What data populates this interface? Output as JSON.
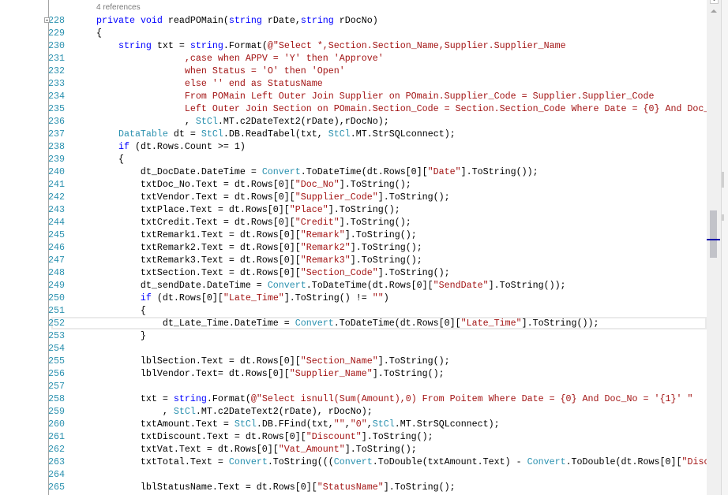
{
  "editor": {
    "codelens": "4 references",
    "current_line": 252,
    "colors": {
      "keyword": "#0000ff",
      "type": "#2b91af",
      "string": "#a31515",
      "line_number": "#2b91af"
    },
    "lines": [
      {
        "num": "228",
        "fold": true,
        "tokens": [
          [
            "p",
            "        "
          ],
          [
            "k",
            "private"
          ],
          [
            "p",
            " "
          ],
          [
            "k",
            "void"
          ],
          [
            "p",
            " readPOMain("
          ],
          [
            "k",
            "string"
          ],
          [
            "p",
            " rDate,"
          ],
          [
            "k",
            "string"
          ],
          [
            "p",
            " rDocNo)"
          ]
        ]
      },
      {
        "num": "229",
        "tokens": [
          [
            "p",
            "        {"
          ]
        ]
      },
      {
        "num": "230",
        "tokens": [
          [
            "p",
            "            "
          ],
          [
            "k",
            "string"
          ],
          [
            "p",
            " txt = "
          ],
          [
            "k",
            "string"
          ],
          [
            "p",
            ".Format("
          ],
          [
            "s",
            "@\"Select *,Section.Section_Name,Supplier.Supplier_Name"
          ]
        ]
      },
      {
        "num": "231",
        "tokens": [
          [
            "p",
            "                        "
          ],
          [
            "s",
            ",case when APPV = 'Y' then 'Approve'"
          ]
        ]
      },
      {
        "num": "232",
        "tokens": [
          [
            "p",
            "                        "
          ],
          [
            "s",
            "when Status = 'O' then 'Open'"
          ]
        ]
      },
      {
        "num": "233",
        "tokens": [
          [
            "p",
            "                        "
          ],
          [
            "s",
            "else '' end as StatusName"
          ]
        ]
      },
      {
        "num": "234",
        "tokens": [
          [
            "p",
            "                        "
          ],
          [
            "s",
            "From POMain Left Outer Join Supplier on POmain.Supplier_Code = Supplier.Supplier_Code"
          ]
        ]
      },
      {
        "num": "235",
        "tokens": [
          [
            "p",
            "                        "
          ],
          [
            "s",
            "Left Outer Join Section on POmain.Section_Code = Section.Section_Code Where Date = {0} And Doc_"
          ]
        ]
      },
      {
        "num": "236",
        "tokens": [
          [
            "p",
            "                        , "
          ],
          [
            "t",
            "StCl"
          ],
          [
            "p",
            ".MT.c2DateText2(rDate),rDocNo);"
          ]
        ]
      },
      {
        "num": "237",
        "tokens": [
          [
            "p",
            "            "
          ],
          [
            "t",
            "DataTable"
          ],
          [
            "p",
            " dt = "
          ],
          [
            "t",
            "StCl"
          ],
          [
            "p",
            ".DB.ReadTabel(txt, "
          ],
          [
            "t",
            "StCl"
          ],
          [
            "p",
            ".MT.StrSQLconnect);"
          ]
        ]
      },
      {
        "num": "238",
        "tokens": [
          [
            "p",
            "            "
          ],
          [
            "k",
            "if"
          ],
          [
            "p",
            " (dt.Rows.Count >= 1)"
          ]
        ]
      },
      {
        "num": "239",
        "tokens": [
          [
            "p",
            "            {"
          ]
        ]
      },
      {
        "num": "240",
        "tokens": [
          [
            "p",
            "                dt_DocDate.DateTime = "
          ],
          [
            "t",
            "Convert"
          ],
          [
            "p",
            ".ToDateTime(dt.Rows[0]["
          ],
          [
            "s",
            "\"Date\""
          ],
          [
            "p",
            "].ToString());"
          ]
        ]
      },
      {
        "num": "241",
        "tokens": [
          [
            "p",
            "                txtDoc_No.Text = dt.Rows[0]["
          ],
          [
            "s",
            "\"Doc_No\""
          ],
          [
            "p",
            "].ToString();"
          ]
        ]
      },
      {
        "num": "242",
        "tokens": [
          [
            "p",
            "                txtVendor.Text = dt.Rows[0]["
          ],
          [
            "s",
            "\"Supplier_Code\""
          ],
          [
            "p",
            "].ToString();"
          ]
        ]
      },
      {
        "num": "243",
        "tokens": [
          [
            "p",
            "                txtPlace.Text = dt.Rows[0]["
          ],
          [
            "s",
            "\"Place\""
          ],
          [
            "p",
            "].ToString();"
          ]
        ]
      },
      {
        "num": "244",
        "tokens": [
          [
            "p",
            "                txtCredit.Text = dt.Rows[0]["
          ],
          [
            "s",
            "\"Credit\""
          ],
          [
            "p",
            "].ToString();"
          ]
        ]
      },
      {
        "num": "245",
        "tokens": [
          [
            "p",
            "                txtRemark1.Text = dt.Rows[0]["
          ],
          [
            "s",
            "\"Remark\""
          ],
          [
            "p",
            "].ToString();"
          ]
        ]
      },
      {
        "num": "246",
        "tokens": [
          [
            "p",
            "                txtRemark2.Text = dt.Rows[0]["
          ],
          [
            "s",
            "\"Remark2\""
          ],
          [
            "p",
            "].ToString();"
          ]
        ]
      },
      {
        "num": "247",
        "tokens": [
          [
            "p",
            "                txtRemark3.Text = dt.Rows[0]["
          ],
          [
            "s",
            "\"Remark3\""
          ],
          [
            "p",
            "].ToString();"
          ]
        ]
      },
      {
        "num": "248",
        "tokens": [
          [
            "p",
            "                txtSection.Text = dt.Rows[0]["
          ],
          [
            "s",
            "\"Section_Code\""
          ],
          [
            "p",
            "].ToString();"
          ]
        ]
      },
      {
        "num": "249",
        "tokens": [
          [
            "p",
            "                dt_sendDate.DateTime = "
          ],
          [
            "t",
            "Convert"
          ],
          [
            "p",
            ".ToDateTime(dt.Rows[0]["
          ],
          [
            "s",
            "\"SendDate\""
          ],
          [
            "p",
            "].ToString());"
          ]
        ]
      },
      {
        "num": "250",
        "tokens": [
          [
            "p",
            "                "
          ],
          [
            "k",
            "if"
          ],
          [
            "p",
            " (dt.Rows[0]["
          ],
          [
            "s",
            "\"Late_Time\""
          ],
          [
            "p",
            "].ToString() != "
          ],
          [
            "s",
            "\"\""
          ],
          [
            "p",
            ")"
          ]
        ]
      },
      {
        "num": "251",
        "tokens": [
          [
            "p",
            "                {"
          ]
        ]
      },
      {
        "num": "252",
        "tokens": [
          [
            "p",
            "                    dt_Late_Time.DateTime = "
          ],
          [
            "t",
            "Convert"
          ],
          [
            "p",
            ".ToDateTime(dt.Rows[0]["
          ],
          [
            "s",
            "\"Late_Time\""
          ],
          [
            "p",
            "].ToString());"
          ]
        ]
      },
      {
        "num": "253",
        "tokens": [
          [
            "p",
            "                }"
          ]
        ]
      },
      {
        "num": "254",
        "tokens": []
      },
      {
        "num": "255",
        "tokens": [
          [
            "p",
            "                lblSection.Text = dt.Rows[0]["
          ],
          [
            "s",
            "\"Section_Name\""
          ],
          [
            "p",
            "].ToString();"
          ]
        ]
      },
      {
        "num": "256",
        "tokens": [
          [
            "p",
            "                lblVendor.Text= dt.Rows[0]["
          ],
          [
            "s",
            "\"Supplier_Name\""
          ],
          [
            "p",
            "].ToString();"
          ]
        ]
      },
      {
        "num": "257",
        "tokens": []
      },
      {
        "num": "258",
        "tokens": [
          [
            "p",
            "                txt = "
          ],
          [
            "k",
            "string"
          ],
          [
            "p",
            ".Format("
          ],
          [
            "s",
            "@\"Select isnull(Sum(Amount),0) From Poitem Where Date = {0} And Doc_No = '{1}' \""
          ]
        ]
      },
      {
        "num": "259",
        "tokens": [
          [
            "p",
            "                    , "
          ],
          [
            "t",
            "StCl"
          ],
          [
            "p",
            ".MT.c2DateText2(rDate), rDocNo);"
          ]
        ]
      },
      {
        "num": "260",
        "tokens": [
          [
            "p",
            "                txtAmount.Text = "
          ],
          [
            "t",
            "StCl"
          ],
          [
            "p",
            ".DB.FFind(txt,"
          ],
          [
            "s",
            "\"\""
          ],
          [
            "p",
            ","
          ],
          [
            "s",
            "\"0\""
          ],
          [
            "p",
            ","
          ],
          [
            "t",
            "StCl"
          ],
          [
            "p",
            ".MT.StrSQLconnect);"
          ]
        ]
      },
      {
        "num": "261",
        "tokens": [
          [
            "p",
            "                txtDiscount.Text = dt.Rows[0]["
          ],
          [
            "s",
            "\"Discount\""
          ],
          [
            "p",
            "].ToString();"
          ]
        ]
      },
      {
        "num": "262",
        "tokens": [
          [
            "p",
            "                txtVat.Text = dt.Rows[0]["
          ],
          [
            "s",
            "\"Vat_Amount\""
          ],
          [
            "p",
            "].ToString();"
          ]
        ]
      },
      {
        "num": "263",
        "tokens": [
          [
            "p",
            "                txtTotal.Text = "
          ],
          [
            "t",
            "Convert"
          ],
          [
            "p",
            ".ToString((("
          ],
          [
            "t",
            "Convert"
          ],
          [
            "p",
            ".ToDouble(txtAmount.Text) - "
          ],
          [
            "t",
            "Convert"
          ],
          [
            "p",
            ".ToDouble(dt.Rows[0]["
          ],
          [
            "s",
            "\"Disc"
          ]
        ]
      },
      {
        "num": "264",
        "tokens": []
      },
      {
        "num": "265",
        "tokens": [
          [
            "p",
            "                lblStatusName.Text = dt.Rows[0]["
          ],
          [
            "s",
            "\"StatusName\""
          ],
          [
            "p",
            "].ToString();"
          ]
        ]
      }
    ]
  },
  "scrollbar": {
    "icons": {
      "up": "arrow-up-icon",
      "split": "split-arrow-icon"
    }
  }
}
